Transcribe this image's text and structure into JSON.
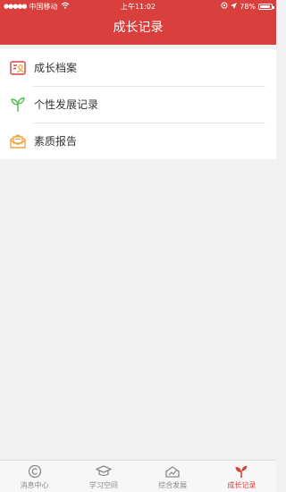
{
  "status": {
    "carrier": "中国移动",
    "time": "上午11:02",
    "battery": "78%"
  },
  "header": {
    "title": "成长记录"
  },
  "menu": [
    {
      "label": "成长档案",
      "icon": "profile-card-icon"
    },
    {
      "label": "个性发展记录",
      "icon": "sprout-icon"
    },
    {
      "label": "素质报告",
      "icon": "report-envelope-icon"
    }
  ],
  "tabs": [
    {
      "label": "消息中心",
      "icon": "message-icon",
      "active": false
    },
    {
      "label": "学习空间",
      "icon": "graduation-cap-icon",
      "active": false
    },
    {
      "label": "综合发展",
      "icon": "development-icon",
      "active": false
    },
    {
      "label": "成长记录",
      "icon": "sprout-icon",
      "active": true
    }
  ],
  "colors": {
    "brand_red": "#d9403d",
    "icon_orange": "#f0a23b",
    "icon_green": "#5cbf5a"
  }
}
